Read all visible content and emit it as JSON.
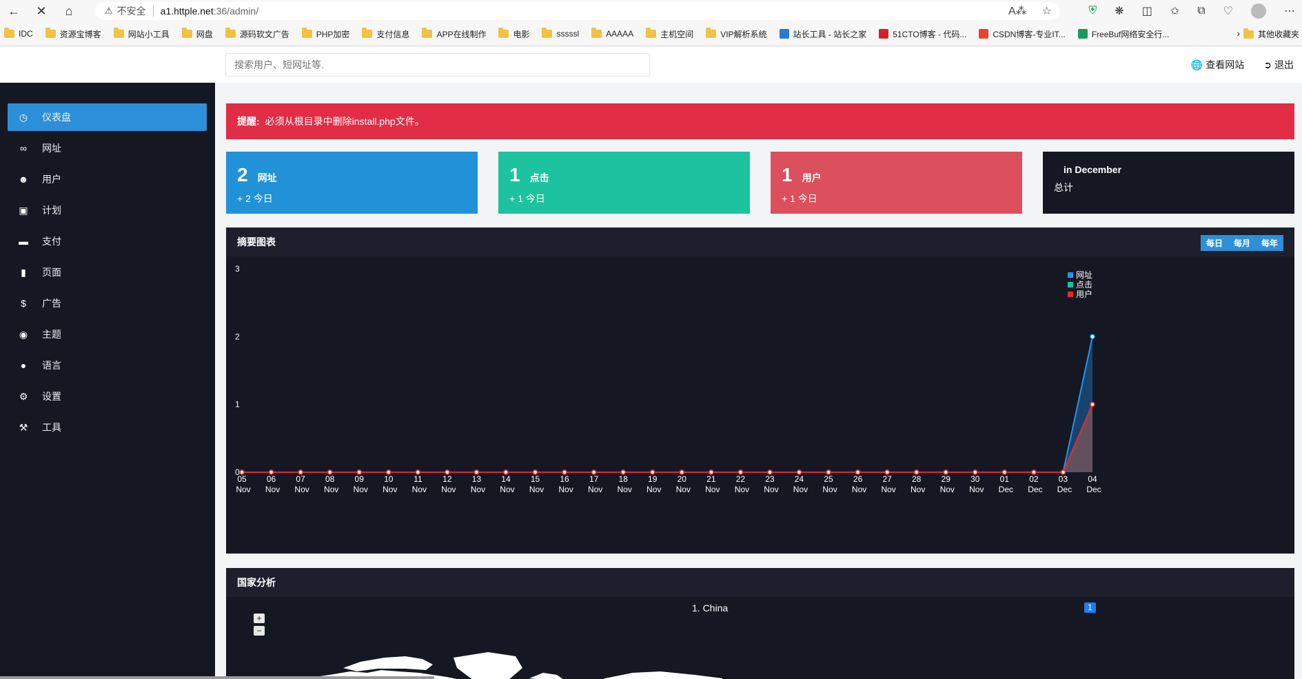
{
  "browser": {
    "insecure_label": "不安全",
    "url_host": "a1.httple.net",
    "url_path": ":36/admin/",
    "bookmarks": [
      "IDC",
      "资源宝博客",
      "网站小工具",
      "网盘",
      "源码软文广告",
      "PHP加密",
      "支付信息",
      "APP在线制作",
      "电影",
      "sssssl",
      "AAAAA",
      "主机空间",
      "VIP解析系统"
    ],
    "bookmarks_special": [
      {
        "label": "站长工具 - 站长之家",
        "color": "#2a7bd5"
      },
      {
        "label": "51CTO博客 - 代码...",
        "color": "#d3222f"
      },
      {
        "label": "CSDN博客-专业IT...",
        "color": "#e8432e"
      },
      {
        "label": "FreeBuf网络安全行...",
        "color": "#1a9a5a"
      }
    ],
    "other_bookmarks": "其他收藏夹"
  },
  "topbar": {
    "search_placeholder": "搜索用户、短网址等.",
    "view_site": "查看网站",
    "logout": "退出"
  },
  "sidebar": {
    "items": [
      {
        "label": "仪表盘",
        "icon": "dashboard-icon",
        "active": true
      },
      {
        "label": "网址",
        "icon": "link-icon"
      },
      {
        "label": "用户",
        "icon": "user-icon"
      },
      {
        "label": "计划",
        "icon": "briefcase-icon"
      },
      {
        "label": "支付",
        "icon": "credit-card-icon"
      },
      {
        "label": "页面",
        "icon": "page-icon"
      },
      {
        "label": "广告",
        "icon": "dollar-icon"
      },
      {
        "label": "主题",
        "icon": "eye-icon"
      },
      {
        "label": "语言",
        "icon": "globe-icon"
      },
      {
        "label": "设置",
        "icon": "gear-icon"
      },
      {
        "label": "工具",
        "icon": "wrench-icon"
      }
    ]
  },
  "alert": {
    "title": "提醒:",
    "message": "必须从根目录中删除install.php文件。"
  },
  "stats": [
    {
      "num": "2",
      "label": "网址",
      "sub": "+ 2 今日",
      "color": "#2191d8"
    },
    {
      "num": "1",
      "label": "点击",
      "sub": "+ 1 今日",
      "color": "#1cc39e"
    },
    {
      "num": "1",
      "label": "用户",
      "sub": "+ 1 今日",
      "color": "#dc4f5d"
    },
    {
      "num": "",
      "label": "in December",
      "sub": "总计",
      "color": "#151823"
    }
  ],
  "chart_panel": {
    "title": "摘要图表",
    "tabs": [
      "每日",
      "每月",
      "每年"
    ]
  },
  "chart_data": {
    "type": "area",
    "x": [
      "05 Nov",
      "06 Nov",
      "07 Nov",
      "08 Nov",
      "09 Nov",
      "10 Nov",
      "11 Nov",
      "12 Nov",
      "13 Nov",
      "14 Nov",
      "15 Nov",
      "16 Nov",
      "17 Nov",
      "18 Nov",
      "19 Nov",
      "20 Nov",
      "21 Nov",
      "22 Nov",
      "23 Nov",
      "24 Nov",
      "25 Nov",
      "26 Nov",
      "27 Nov",
      "28 Nov",
      "29 Nov",
      "30 Nov",
      "01 Dec",
      "02 Dec",
      "03 Dec",
      "04 Dec"
    ],
    "series": [
      {
        "name": "网址",
        "color": "#2196f3",
        "values": [
          0,
          0,
          0,
          0,
          0,
          0,
          0,
          0,
          0,
          0,
          0,
          0,
          0,
          0,
          0,
          0,
          0,
          0,
          0,
          0,
          0,
          0,
          0,
          0,
          0,
          0,
          0,
          0,
          0,
          2
        ]
      },
      {
        "name": "点击",
        "color": "#1cc39e",
        "values": [
          0,
          0,
          0,
          0,
          0,
          0,
          0,
          0,
          0,
          0,
          0,
          0,
          0,
          0,
          0,
          0,
          0,
          0,
          0,
          0,
          0,
          0,
          0,
          0,
          0,
          0,
          0,
          0,
          0,
          1
        ]
      },
      {
        "name": "用户",
        "color": "#e8262d",
        "values": [
          0,
          0,
          0,
          0,
          0,
          0,
          0,
          0,
          0,
          0,
          0,
          0,
          0,
          0,
          0,
          0,
          0,
          0,
          0,
          0,
          0,
          0,
          0,
          0,
          0,
          0,
          0,
          0,
          0,
          1
        ]
      }
    ],
    "yticks": [
      0,
      1,
      2,
      3
    ],
    "ylim": [
      0,
      3
    ],
    "legend": "top-right"
  },
  "map_panel": {
    "title": "国家分析",
    "zoom_in": "+",
    "zoom_out": "−",
    "countries": [
      {
        "label": "1. China",
        "count": "1"
      }
    ]
  }
}
